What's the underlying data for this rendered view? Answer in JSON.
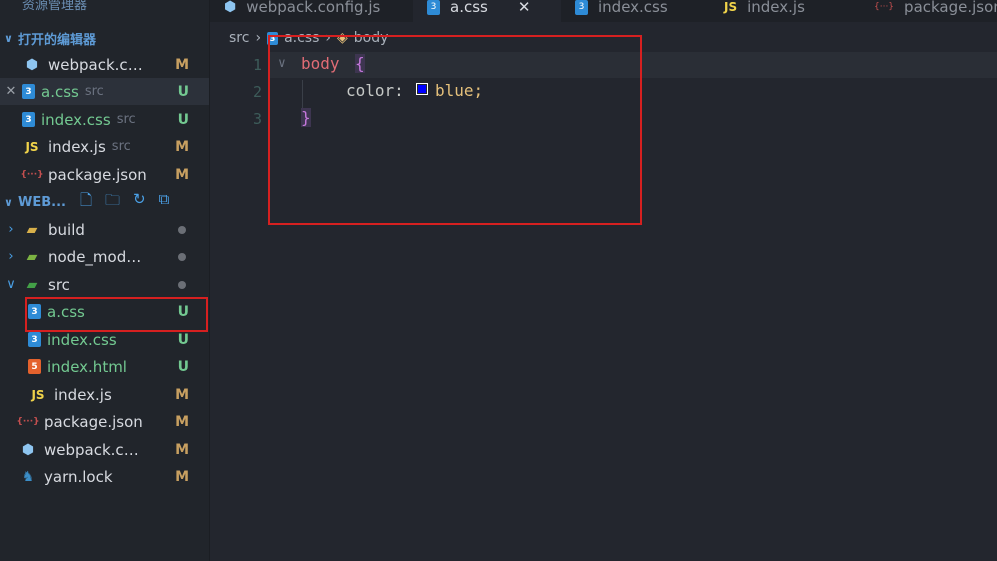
{
  "sidebar": {
    "top_title": "资源管理器",
    "open_editors": {
      "title": "打开的编辑器",
      "items": [
        {
          "name": "webpack.co...",
          "dir": "",
          "badge": "M"
        },
        {
          "name": "a.css",
          "dir": "src",
          "badge": "U"
        },
        {
          "name": "index.css",
          "dir": "src",
          "badge": "U"
        },
        {
          "name": "index.js",
          "dir": "src",
          "badge": "M"
        },
        {
          "name": "package.json",
          "dir": "",
          "badge": "M"
        }
      ]
    },
    "workspace": {
      "title": "WEB...",
      "tree": [
        {
          "name": "build"
        },
        {
          "name": "node_modu..."
        },
        {
          "name": "src"
        },
        {
          "name": "a.css",
          "badge": "U"
        },
        {
          "name": "index.css",
          "badge": "U"
        },
        {
          "name": "index.html",
          "badge": "U"
        },
        {
          "name": "index.js",
          "badge": "M"
        },
        {
          "name": "package.json",
          "badge": "M"
        },
        {
          "name": "webpack.co...",
          "badge": "M"
        },
        {
          "name": "yarn.lock",
          "badge": "M"
        }
      ]
    }
  },
  "tabs": [
    {
      "label": "webpack.config.js"
    },
    {
      "label": "a.css"
    },
    {
      "label": "index.css"
    },
    {
      "label": "index.js"
    },
    {
      "label": "package.json"
    }
  ],
  "breadcrumb": {
    "folder": "src",
    "file": "a.css",
    "symbol": "body"
  },
  "editor": {
    "line_numbers": [
      "1",
      "2",
      "3"
    ],
    "selector": "body",
    "open_brace": "{",
    "property": "color:",
    "value": "blue;",
    "close_brace": "}",
    "swatch_color": "#0000ff"
  },
  "icons": {
    "css": "3",
    "html": "5",
    "js": "JS",
    "json": "{}",
    "close": "×",
    "chevron_right": "›",
    "chevron_down": "∨"
  }
}
